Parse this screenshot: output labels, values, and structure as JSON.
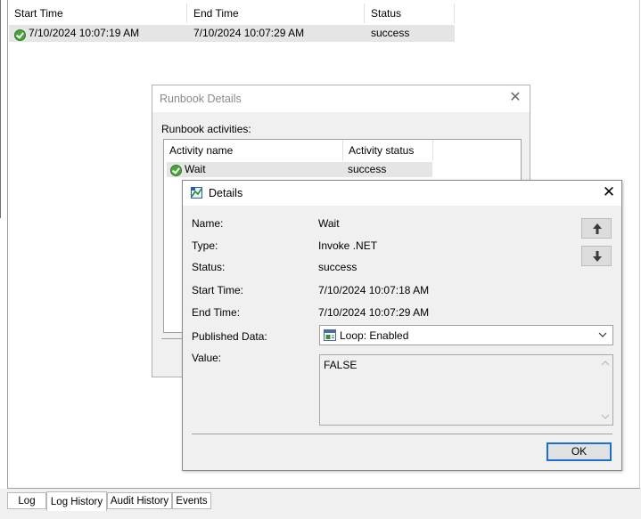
{
  "main_table": {
    "headers": [
      "Start Time",
      "End Time",
      "Status"
    ],
    "rows": [
      {
        "start": "7/10/2024 10:07:19 AM",
        "end": "7/10/2024 10:07:29 AM",
        "status": "success"
      }
    ]
  },
  "runbook_dialog": {
    "title": "Runbook Details",
    "activities_label": "Runbook activities:",
    "headers": [
      "Activity name",
      "Activity status"
    ],
    "rows": [
      {
        "name": "Wait",
        "status": "success"
      }
    ]
  },
  "details_dialog": {
    "title": "Details",
    "fields": {
      "name_label": "Name:",
      "name_value": "Wait",
      "type_label": "Type:",
      "type_value": "Invoke .NET",
      "status_label": "Status:",
      "status_value": "success",
      "start_label": "Start Time:",
      "start_value": "7/10/2024 10:07:18 AM",
      "end_label": "End Time:",
      "end_value": "7/10/2024 10:07:29 AM",
      "published_label": "Published Data:",
      "published_value": "Loop: Enabled",
      "value_label": "Value:",
      "value_text": "FALSE"
    },
    "ok_label": "OK"
  },
  "tabs": [
    "Log",
    "Log History",
    "Audit History",
    "Events"
  ],
  "active_tab": "Log History",
  "colors": {
    "accent": "#1a6fd1",
    "success": "#4aa33a"
  }
}
